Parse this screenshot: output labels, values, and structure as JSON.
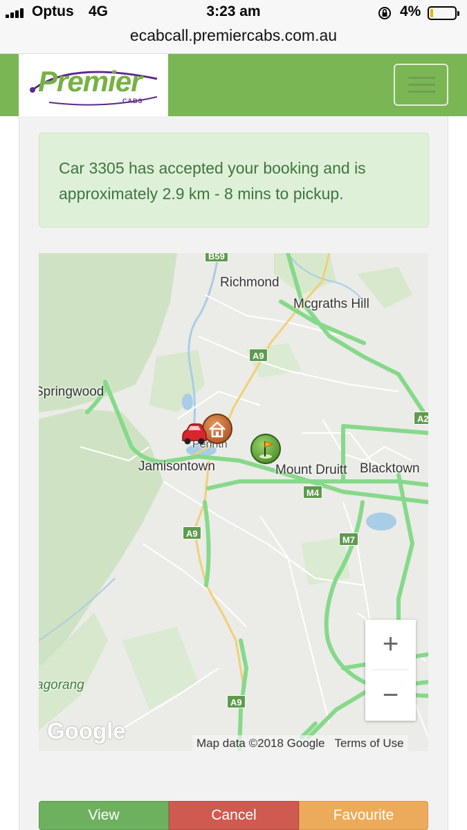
{
  "status_bar": {
    "carrier": "Optus",
    "network": "4G",
    "time": "3:23 am",
    "battery_percent": "4%",
    "battery_level": 0.04
  },
  "browser": {
    "url": "ecabcall.premiercabs.com.au"
  },
  "header": {
    "logo_text": "Premier",
    "logo_subtext": "CABS",
    "menu_icon": "hamburger-menu-icon",
    "brand_color": "#7ab653"
  },
  "alert": {
    "message": "Car 3305 has accepted your booking and is approximately 2.9 km - 8 mins to pickup."
  },
  "map": {
    "places": {
      "richmond": "Richmond",
      "mcgraths_hill": "Mcgraths Hill",
      "springwood": "Springwood",
      "penrith": "Penrith",
      "jamisontown": "Jamisontown",
      "mount_druitt": "Mount Druitt",
      "blacktown": "Blacktown",
      "kurrajong": "agorang"
    },
    "road_shields": {
      "b59": "B59",
      "a9_north": "A9",
      "a9_mid": "A9",
      "a9_south": "A9",
      "m4": "M4",
      "m7": "M7",
      "a2": "A2"
    },
    "markers": {
      "car": "car-marker-icon",
      "home": "home-marker-icon",
      "destination": "flag-marker-icon"
    },
    "zoom_in_label": "+",
    "zoom_out_label": "−",
    "google_logo": "Google",
    "map_data": "Map data ©2018 Google",
    "terms": "Terms of Use",
    "road_color": "#86d98a"
  },
  "actions": {
    "view": "View",
    "cancel": "Cancel",
    "favourite": "Favourite",
    "view_color": "#6db05e",
    "cancel_color": "#cf5a4f",
    "favourite_color": "#ecab5a"
  }
}
